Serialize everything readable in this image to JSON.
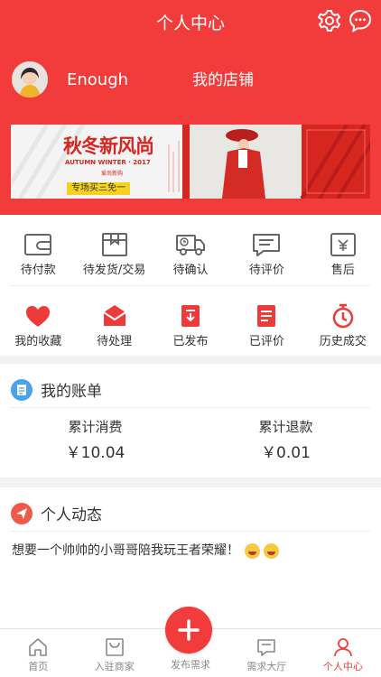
{
  "app": {
    "title": "个人中心",
    "accent": "#f23c3c"
  },
  "header": {
    "username": "Enough",
    "shop_label": "我的店铺"
  },
  "banner": {
    "title": "秋冬新风尚",
    "subtitle": "AUTUMN WINTER · 2017",
    "small_text": "爱尚新购",
    "promo": "专场买三免一"
  },
  "orders": {
    "row1": [
      {
        "label": "待付款",
        "icon": "wallet-icon"
      },
      {
        "label": "待发货/交易",
        "icon": "package-icon"
      },
      {
        "label": "待确认",
        "icon": "truck-icon"
      },
      {
        "label": "待评价",
        "icon": "comment-icon"
      },
      {
        "label": "售后",
        "icon": "refund-icon"
      }
    ],
    "row2": [
      {
        "label": "我的收藏",
        "icon": "heart-icon"
      },
      {
        "label": "待处理",
        "icon": "mail-icon"
      },
      {
        "label": "已发布",
        "icon": "download-icon"
      },
      {
        "label": "已评价",
        "icon": "document-icon"
      },
      {
        "label": "历史成交",
        "icon": "stopwatch-icon"
      }
    ]
  },
  "bill": {
    "title": "我的账单",
    "spend_label": "累计消费",
    "spend_value": "￥10.04",
    "refund_label": "累计退款",
    "refund_value": "￥0.01"
  },
  "dynamics": {
    "title": "个人动态",
    "post_text": "想要一个帅帅的小哥哥陪我玩王者荣耀！"
  },
  "tabbar": {
    "items": [
      {
        "label": "首页",
        "icon": "home-icon"
      },
      {
        "label": "入驻商家",
        "icon": "store-icon"
      },
      {
        "label": "发布需求",
        "icon": "plus-icon"
      },
      {
        "label": "需求大厅",
        "icon": "chat-icon"
      },
      {
        "label": "个人中心",
        "icon": "person-icon"
      }
    ],
    "active_index": 4
  }
}
